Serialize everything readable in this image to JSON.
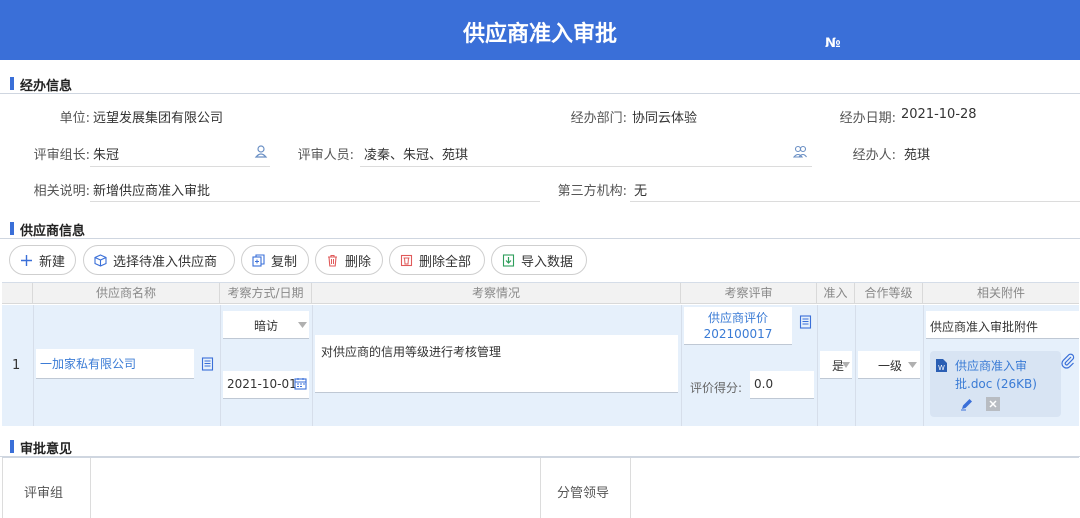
{
  "header": {
    "title": "供应商准入审批",
    "number_label": "№"
  },
  "sections": {
    "handling": "经办信息",
    "supplier": "供应商信息",
    "approval": "审批意见"
  },
  "handling": {
    "unit_label": "单位:",
    "unit_value": "远望发展集团有限公司",
    "dept_label": "经办部门:",
    "dept_value": "协同云体验",
    "date_label": "经办日期:",
    "date_value": "2021-10-28",
    "leader_label": "评审组长:",
    "leader_value": "朱冠",
    "reviewers_label": "评审人员:",
    "reviewers_value": "凌秦、朱冠、苑琪",
    "handler_label": "经办人:",
    "handler_value": "苑琪",
    "desc_label": "相关说明:",
    "desc_value": "新增供应商准入审批",
    "third_label": "第三方机构:",
    "third_value": "无"
  },
  "toolbar": {
    "new_label": "新建",
    "select_label": "选择待准入供应商",
    "copy_label": "复制",
    "delete_label": "删除",
    "delete_all_label": "删除全部",
    "import_label": "导入数据"
  },
  "table": {
    "columns": [
      "供应商名称",
      "考察方式/日期",
      "考察情况",
      "考察评审",
      "准入",
      "合作等级",
      "相关附件"
    ],
    "row": {
      "index": "1",
      "supplier_name": "一加家私有限公司",
      "method": "暗访",
      "date": "2021-10-01",
      "situation": "对供应商的信用等级进行考核管理",
      "review_link_line1": "供应商评价",
      "review_link_line2": "202100017",
      "score_label": "评价得分:",
      "score_value": "0.0",
      "admit": "是",
      "level": "一级",
      "attachment_title": "供应商准入审批附件",
      "attachment_file_line1": "供应商准入审",
      "attachment_file_line2": "批.doc (26KB)"
    }
  },
  "approval": {
    "review_group_label": "评审组",
    "leader_label": "分管领导"
  },
  "colors": {
    "accent": "#3a6fd8",
    "row_bg": "#e6f0fb",
    "link": "#3a7bd5"
  }
}
